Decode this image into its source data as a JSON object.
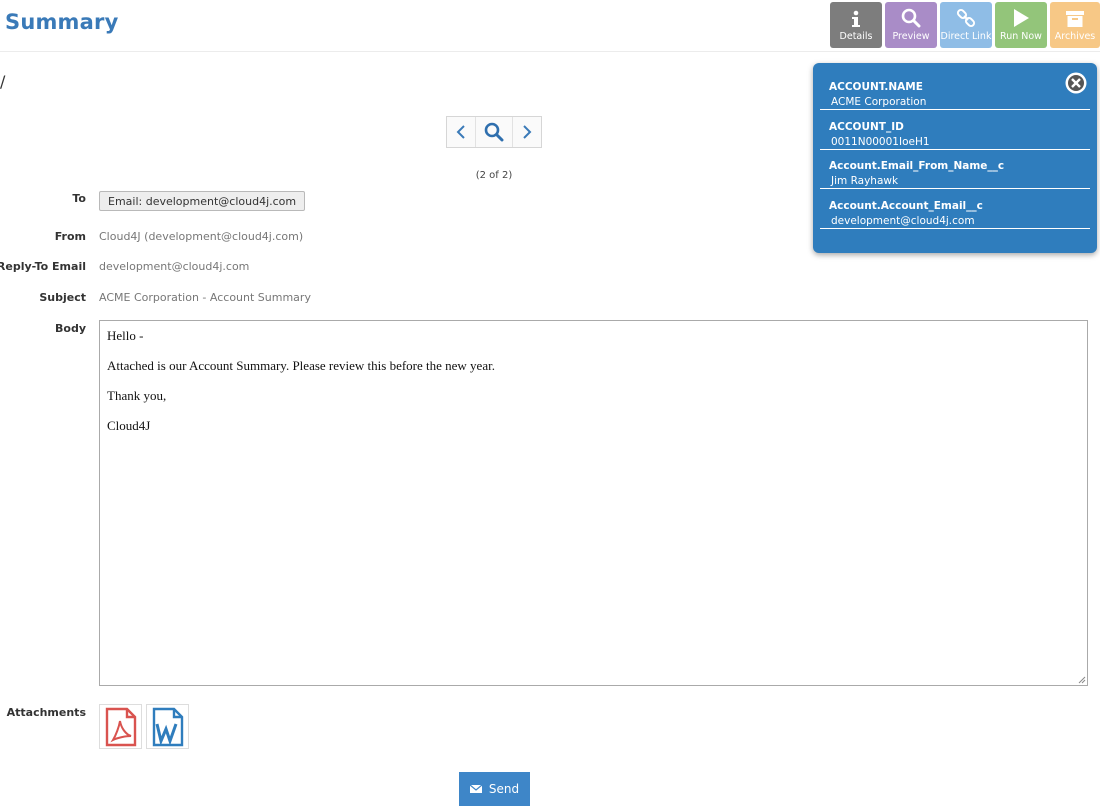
{
  "header": {
    "title": "Summary",
    "slash": "/"
  },
  "toolbar": {
    "details": "Details",
    "preview": "Preview",
    "direct_link": "Direct Link",
    "run_now": "Run Now",
    "archives": "Archives"
  },
  "pager": {
    "count": "(2 of 2)"
  },
  "form": {
    "to_label": "To",
    "to_value": "Email: development@cloud4j.com",
    "from_label": "From",
    "from_value": "Cloud4J (development@cloud4j.com)",
    "reply_label": "Reply-To Email",
    "reply_value": "development@cloud4j.com",
    "subject_label": "Subject",
    "subject_value": "ACME Corporation - Account Summary",
    "body_label": "Body",
    "body_lines": [
      "Hello -",
      "Attached is our Account Summary. Please review this before the new year.",
      "Thank you,",
      "Cloud4J"
    ],
    "attachments_label": "Attachments",
    "send_label": "Send"
  },
  "panel": {
    "fields": [
      {
        "key": "ACCOUNT.NAME",
        "value": "ACME Corporation"
      },
      {
        "key": "ACCOUNT_ID",
        "value": "0011N00001IoeH1"
      },
      {
        "key": "Account.Email_From_Name__c",
        "value": "Jim Rayhawk"
      },
      {
        "key": "Account.Account_Email__c",
        "value": "development@cloud4j.com"
      }
    ]
  },
  "colors": {
    "title": "#3a7ab8",
    "panel": "#2f7dbd",
    "send": "#3e86c8",
    "details": "#7d7d7d",
    "preview": "#a98cc7",
    "direct_link": "#8fbde6",
    "run_now": "#93c57a",
    "archives": "#f7c886",
    "pdf": "#d9534f",
    "word": "#2f7dbd"
  },
  "icons": [
    "info-icon",
    "search-icon",
    "link-icon",
    "play-icon",
    "archive-icon",
    "chevron-left-icon",
    "chevron-right-icon",
    "close-circle-icon",
    "pdf-file-icon",
    "word-file-icon",
    "envelope-icon",
    "resize-handle-icon"
  ]
}
